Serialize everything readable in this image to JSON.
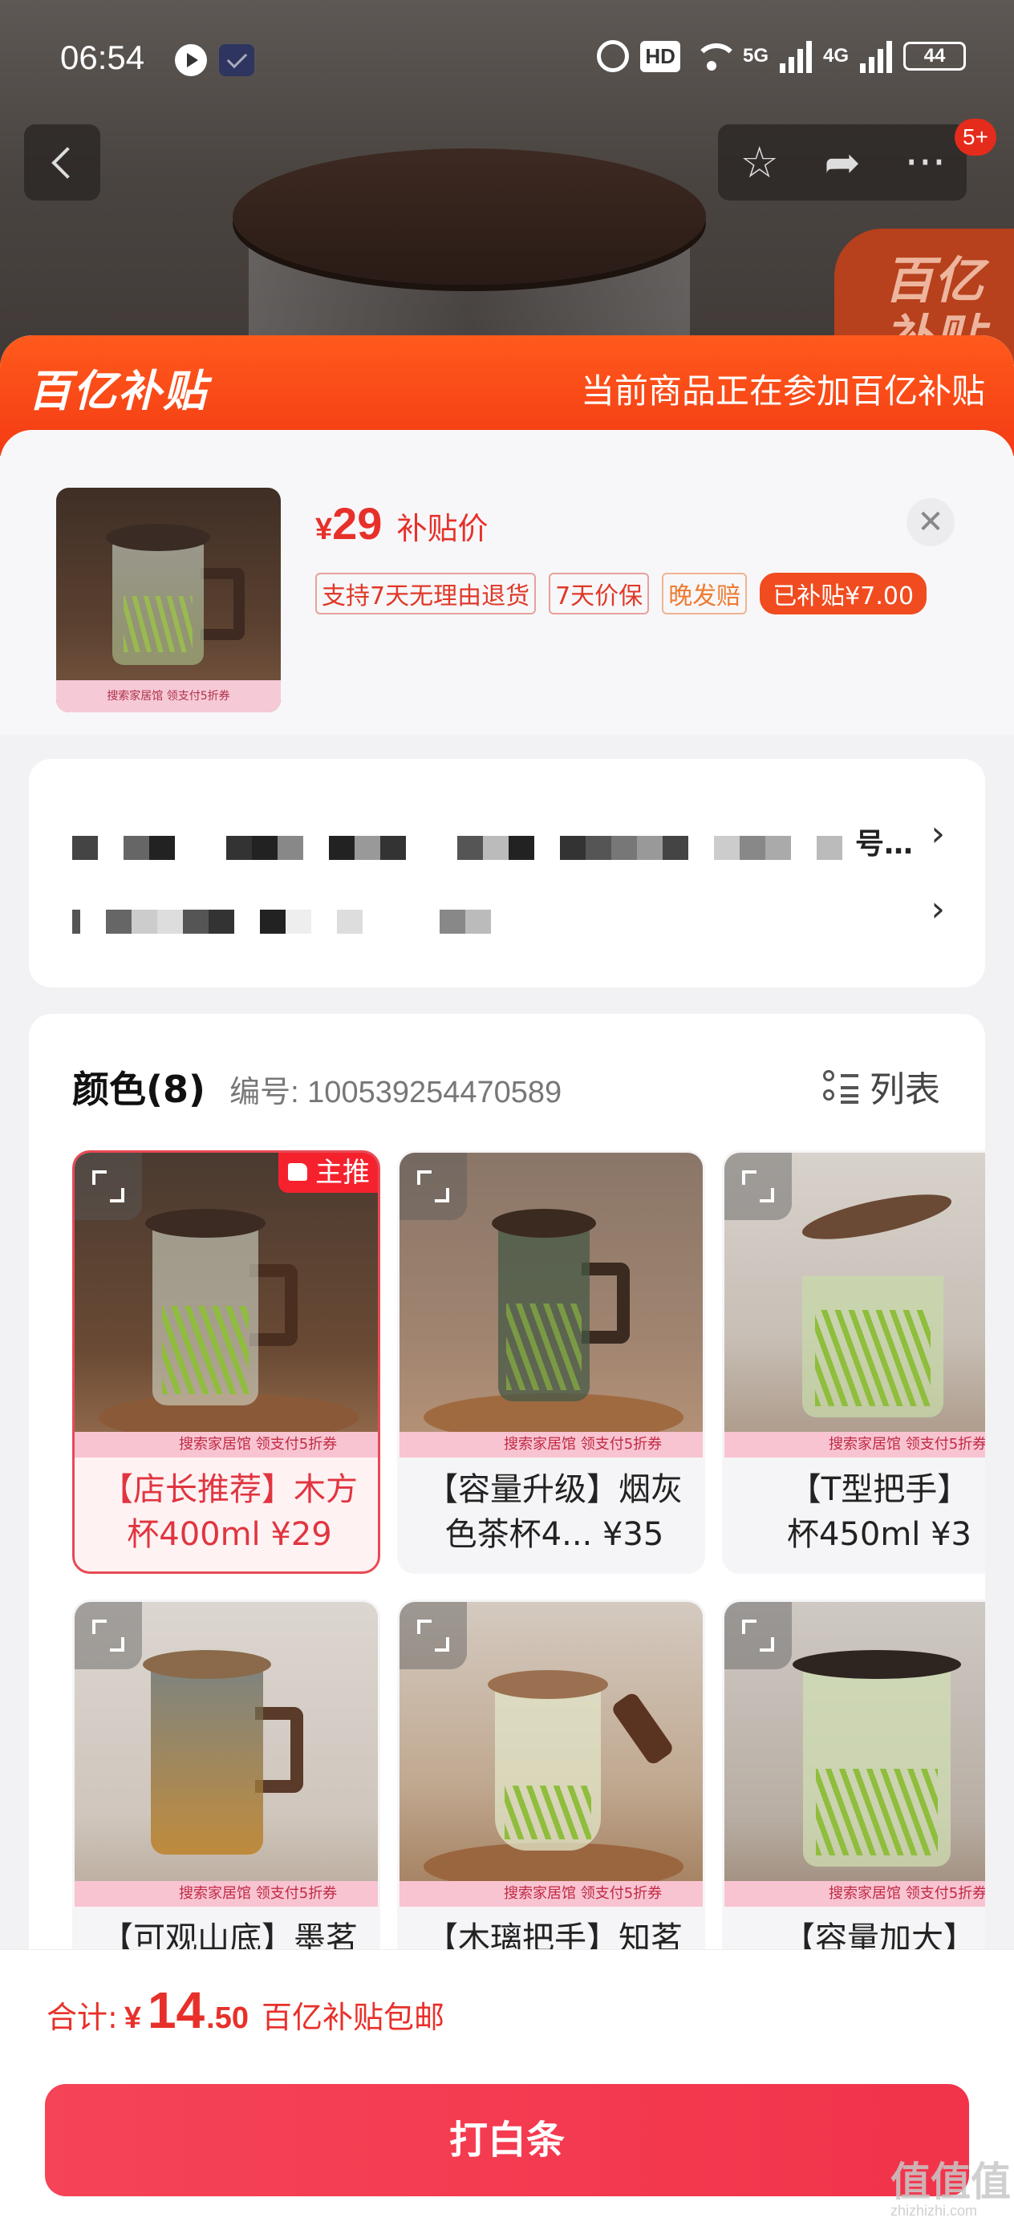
{
  "status_bar": {
    "time": "06:54",
    "hd": "HD",
    "net1": "5G",
    "net2": "4G",
    "battery": "44"
  },
  "nav": {
    "badge": "5+",
    "more": "···"
  },
  "background": {
    "badge_text": "百亿补贴"
  },
  "sheet": {
    "logo": "百亿补贴",
    "banner": "当前商品正在参加百亿补贴",
    "product": {
      "price_symbol": "¥",
      "price": "29",
      "price_label": "补贴价",
      "thumb_strip": "搜索家居馆 领支付5折券",
      "tags": [
        "支持7天无理由退货",
        "7天价保",
        "晚发赔",
        "已补贴¥7.00"
      ],
      "close": "✕"
    },
    "address": {
      "line1_tail": "号…",
      "chevron": "›"
    },
    "variants": {
      "title": "颜色(8)",
      "code": "编号: 100539254470589",
      "list_label": "列表",
      "main_badge": "主推",
      "promo": "搜索家居馆 领支付5折券",
      "items": [
        {
          "name": "【店长推荐】木方杯400ml ¥29"
        },
        {
          "name": "【容量升级】烟灰色茶杯4... ¥35"
        },
        {
          "name": "【T型把手】\n杯450ml ¥3"
        },
        {
          "name": "【可观山底】墨茗"
        },
        {
          "name": "【木璃把手】知茗"
        },
        {
          "name": "【容量加大】"
        }
      ]
    }
  },
  "footer": {
    "total_label": "合计:",
    "currency": "¥",
    "amount_int": "14",
    "amount_dec": ".50",
    "note": "百亿补贴包邮",
    "pay_button": "打白条"
  },
  "watermark": {
    "main": "值值值",
    "sub": "zhizhizhi.com"
  },
  "colors": {
    "accent": "#f04c20",
    "price": "#e8302a",
    "pay": "#f2334a",
    "selected_border": "#e84a55"
  }
}
